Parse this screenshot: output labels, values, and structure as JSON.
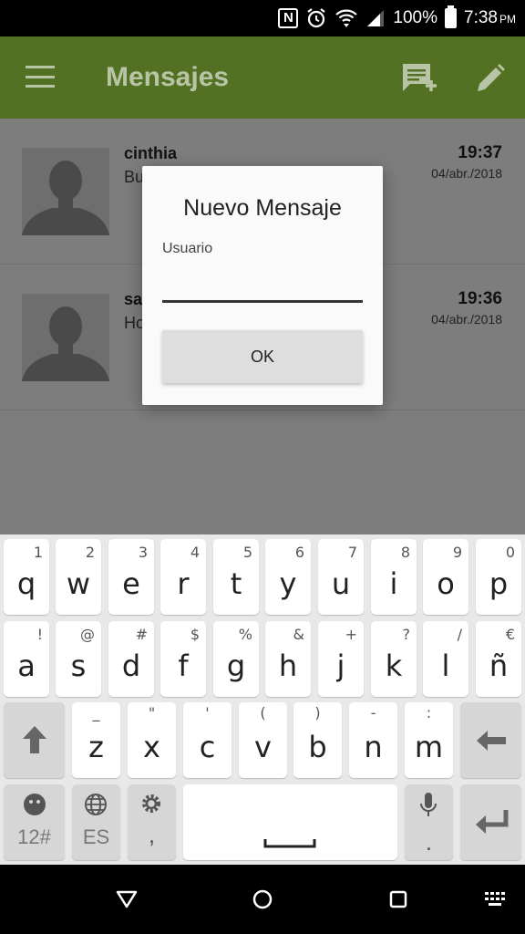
{
  "status_bar": {
    "nfc_icon": "nfc-icon",
    "battery": "100%",
    "time": "7:38",
    "ampm": "PM"
  },
  "app_bar": {
    "title": "Mensajes",
    "color": "#537122"
  },
  "conversations": [
    {
      "name": "cinthia",
      "preview": "Bu",
      "time": "19:37",
      "date": "04/abr./2018"
    },
    {
      "name": "sa",
      "preview": "Ho",
      "time": "19:36",
      "date": "04/abr./2018"
    }
  ],
  "dialog": {
    "title": "Nuevo Mensaje",
    "label": "Usuario",
    "input_value": "",
    "ok_label": "OK"
  },
  "keyboard": {
    "row1": [
      {
        "key": "q",
        "hint": "1"
      },
      {
        "key": "w",
        "hint": "2"
      },
      {
        "key": "e",
        "hint": "3"
      },
      {
        "key": "r",
        "hint": "4"
      },
      {
        "key": "t",
        "hint": "5"
      },
      {
        "key": "y",
        "hint": "6"
      },
      {
        "key": "u",
        "hint": "7"
      },
      {
        "key": "i",
        "hint": "8"
      },
      {
        "key": "o",
        "hint": "9"
      },
      {
        "key": "p",
        "hint": "0"
      }
    ],
    "row2": [
      {
        "key": "a",
        "hint": "!"
      },
      {
        "key": "s",
        "hint": "@"
      },
      {
        "key": "d",
        "hint": "#"
      },
      {
        "key": "f",
        "hint": "$"
      },
      {
        "key": "g",
        "hint": "%"
      },
      {
        "key": "h",
        "hint": "&"
      },
      {
        "key": "j",
        "hint": "+"
      },
      {
        "key": "k",
        "hint": "?"
      },
      {
        "key": "l",
        "hint": "/"
      },
      {
        "key": "ñ",
        "hint": "€"
      }
    ],
    "row3": [
      {
        "key": "z",
        "hint": "_"
      },
      {
        "key": "x",
        "hint": "\""
      },
      {
        "key": "c",
        "hint": "'"
      },
      {
        "key": "v",
        "hint": "("
      },
      {
        "key": "b",
        "hint": ")"
      },
      {
        "key": "n",
        "hint": "-"
      },
      {
        "key": "m",
        "hint": ":"
      }
    ],
    "numbers_label": "12#",
    "language_label": "ES",
    "comma_label": ","
  }
}
